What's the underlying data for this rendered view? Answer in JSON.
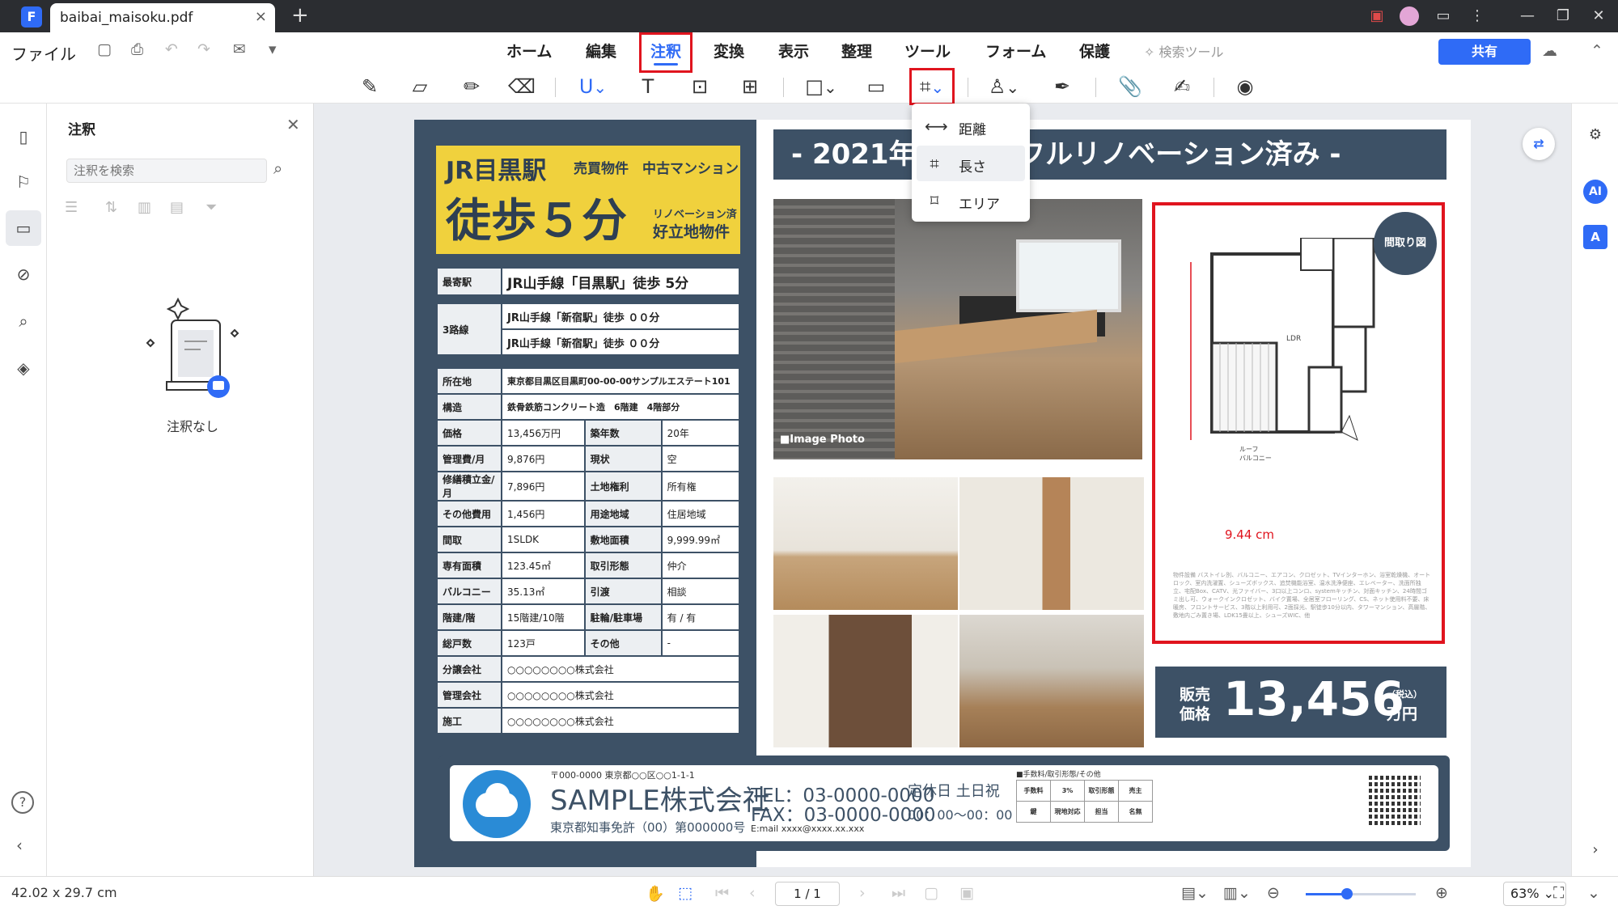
{
  "titlebar": {
    "tab_title": "baibai_maisoku.pdf",
    "tab_close": "×",
    "new_tab": "+"
  },
  "menu": {
    "file": "ファイル",
    "tabs": [
      "ホーム",
      "編集",
      "注釈",
      "変換",
      "表示",
      "整理",
      "ツール",
      "フォーム",
      "保護"
    ],
    "search_tool": "検索ツール",
    "share": "共有"
  },
  "measure_dropdown": {
    "items": [
      "距離",
      "長さ",
      "エリア"
    ],
    "selected": "長さ"
  },
  "comment_panel": {
    "title": "注釈",
    "search_placeholder": "注釈を検索",
    "empty_text": "注釈なし"
  },
  "status": {
    "page_size": "42.02 x 29.7 cm",
    "page": "1 / 1",
    "zoom": "63%",
    "zoom_fraction": 0.33
  },
  "document": {
    "headline": {
      "station": "JR目黒駅",
      "tag": "売買物件　中古マンション",
      "walk": "徒歩５分",
      "sub1": "リノベーション済",
      "sub2": "好立地物件"
    },
    "station_row": {
      "label": "最寄駅",
      "value": "JR山手線「目黒駅」徒歩 5分"
    },
    "routes": {
      "label": "3路線",
      "rows": [
        "JR山手線「新宿駅」徒歩 ００分",
        "JR山手線「新宿駅」徒歩 ００分"
      ]
    },
    "address": {
      "label": "所在地",
      "value": "東京都目黒区目黒町00-00-00サンプルエステート101"
    },
    "structure": {
      "label": "構造",
      "value": "鉄骨鉄筋コンクリート造　6階建　4階部分"
    },
    "details": [
      [
        "価格",
        "13,456万円",
        "築年数",
        "20年"
      ],
      [
        "管理費/月",
        "9,876円",
        "現状",
        "空"
      ],
      [
        "修繕積立金/月",
        "7,896円",
        "土地権利",
        "所有権"
      ],
      [
        "その他費用",
        "1,456円",
        "用途地域",
        "住居地域"
      ],
      [
        "間取",
        "1SLDK",
        "敷地面積",
        "9,999.99㎡"
      ],
      [
        "専有面積",
        "123.45㎡",
        "取引形態",
        "仲介"
      ],
      [
        "バルコニー",
        "35.13㎡",
        "引渡",
        "相談"
      ],
      [
        "階建/階",
        "15階建/10階",
        "駐輪/駐車場",
        "有 / 有"
      ],
      [
        "総戸数",
        "123戸",
        "その他",
        "-"
      ]
    ],
    "companies": [
      [
        "分譲会社",
        "○○○○○○○○株式会社"
      ],
      [
        "管理会社",
        "○○○○○○○○株式会社"
      ],
      [
        "施工",
        "○○○○○○○○株式会社"
      ]
    ],
    "banner": "- 2021年 全部屋 フルリノベーション済み -",
    "photo_caption": "■Image Photo",
    "floorplan": {
      "badge": "間取り図",
      "measure": "9.44 cm",
      "ldr": "LDR",
      "roof": "ルーフ\nバルコニー",
      "notes": "物件設備 バストイレ別、バルコニー、エアコン、クロゼット、TVインターホン、浴室乾燥機、オートロック、室内洗濯置、シューズボックス、追焚機能浴室、温水洗浄便座、エレベーター、洗面所独立、宅配Box、CATV、光ファイバー、3口以上コンロ、systemキッチン、対面キッチン、24時間ゴミ出し可、ウォークインクロゼット、バイク置場、全居室フローリング、CS、ネット使用料不要、床暖房、フロントサービス、3階以上利用可、2面採光、駅徒歩10分以内、タワーマンション、高層階、敷地内ごみ置き場、LDK15畳以上、シューズWIC、他"
    },
    "price": {
      "label1": "販売",
      "label2": "価格",
      "value": "13,456",
      "tax": "（税込）",
      "unit": "万円"
    },
    "footer": {
      "address": "〒000-0000 東京都○○区○○1-1-1",
      "company": "SAMPLE株式会社",
      "license": "東京都知事免許（00）第000000号",
      "tel": "TEL：03-0000-0000",
      "fax": "FAX：03-0000-0000",
      "mail": "E:mail xxxx@xxxx.xx.xxx",
      "holiday": "定休日 土日祝",
      "hours": "00：00〜00：00",
      "fee_title": "■手数料/取引形態/その他",
      "fee_rows": [
        [
          "手数料",
          "3%",
          "取引形態",
          "売主"
        ],
        [
          "鍵",
          "現地対応",
          "担当",
          "名無"
        ]
      ]
    }
  }
}
